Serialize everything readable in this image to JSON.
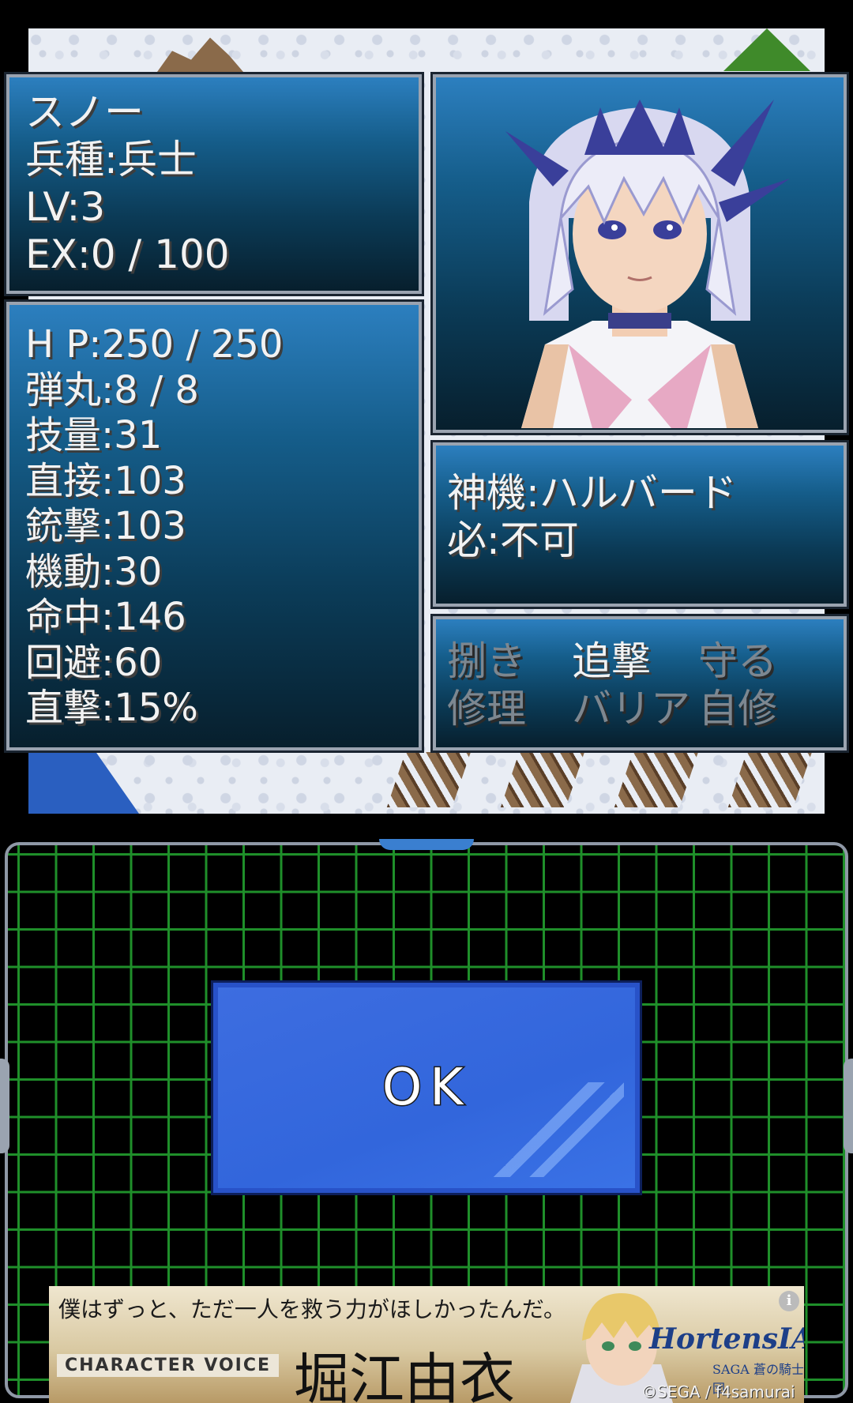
{
  "unit": {
    "name": "スノー",
    "class": "兵種:兵士",
    "level": "LV:3",
    "exp": "EX:0 / 100"
  },
  "stats": [
    "H P:250 / 250",
    "弾丸:8 / 8",
    "技量:31",
    "直接:103",
    "銃撃:103",
    "機動:30",
    "命中:146",
    "回避:60",
    "直撃:15%"
  ],
  "weapon": {
    "name": "神機:ハルバード",
    "special": "必:不可"
  },
  "skills": [
    {
      "label": "捌き",
      "enabled": false
    },
    {
      "label": "追撃",
      "enabled": true
    },
    {
      "label": "守る",
      "enabled": false
    },
    {
      "label": "修理",
      "enabled": false
    },
    {
      "label": "バリア",
      "enabled": false
    },
    {
      "label": "自修",
      "enabled": false
    }
  ],
  "ok_button": {
    "label": "OK"
  },
  "ad": {
    "headline": "僕はずっと、ただ一人を救う力がほしかったんだ。",
    "character_voice_label": "CHARACTER VOICE",
    "voice_actor": "堀江由衣",
    "logo": "HortensIA",
    "logo_sub": "SAGA",
    "logo_subtitle": "蒼の騎士団",
    "copyright": "©SEGA / f4samurai",
    "info_icon": "info-icon"
  },
  "colors": {
    "panel_top": "#2c7fbf",
    "panel_bottom": "#071f2d",
    "grid_line": "#1f8f2a",
    "ok_button": "#3266dc",
    "disabled_text": "#7d8790"
  }
}
